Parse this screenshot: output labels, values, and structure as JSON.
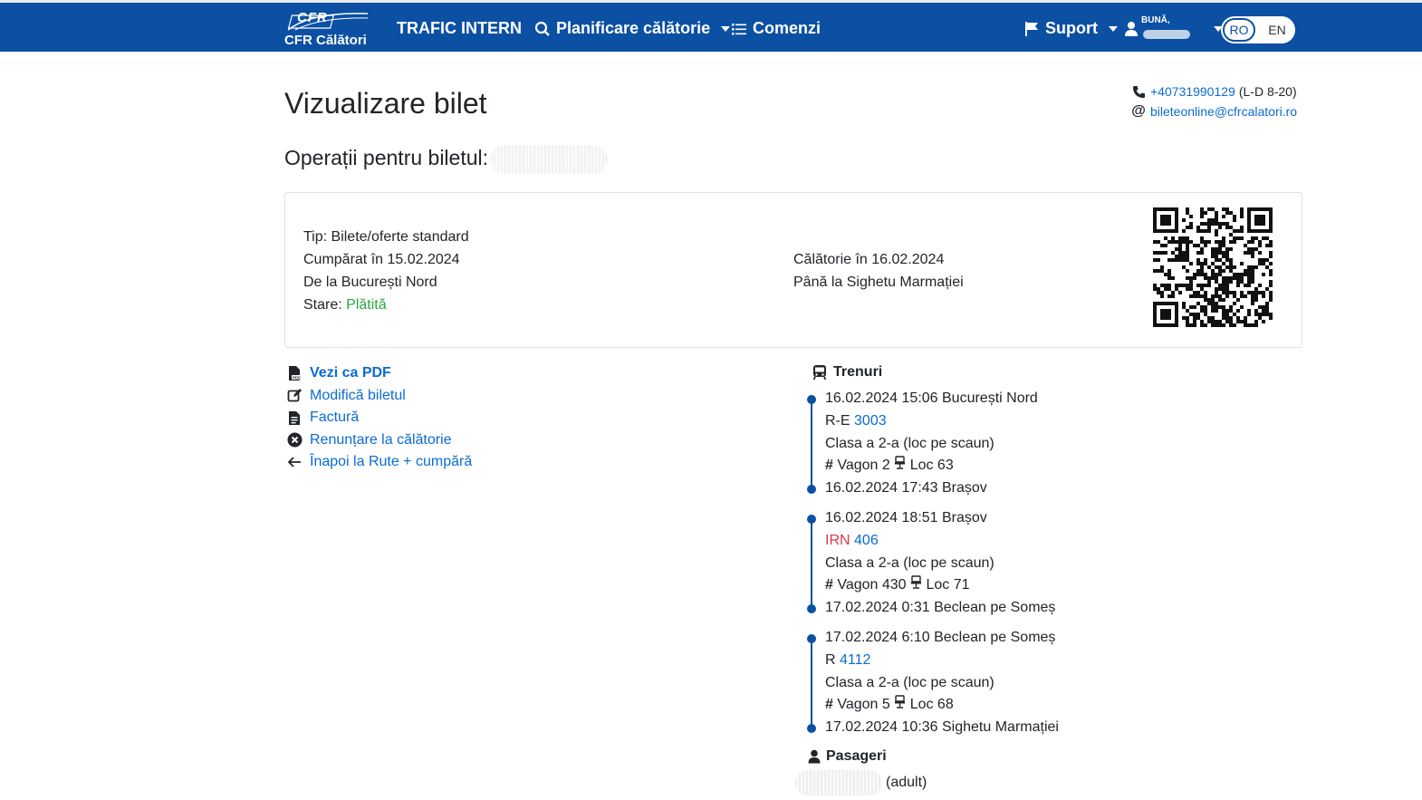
{
  "nav": {
    "logo_abbr": "CFR",
    "logo_name": "CFR Călători",
    "trafic": "TRAFIC INTERN",
    "planificare": "Planificare călătorie",
    "comenzi": "Comenzi",
    "suport": "Suport",
    "greeting": "BUNĂ,",
    "lang_ro": "RO",
    "lang_en": "EN"
  },
  "contact": {
    "phone": "+40731990129",
    "hours": "(L-D 8-20)",
    "email": "bileteonline@cfrcalatori.ro"
  },
  "page": {
    "title": "Vizualizare bilet",
    "subtitle": "Operații pentru biletul:"
  },
  "ticket": {
    "type": "Tip: Bilete/oferte standard",
    "purchased": "Cumpărat în 15.02.2024",
    "from": "De la București Nord",
    "status_label": "Stare: ",
    "status_value": "Plătită",
    "travel": "Călătorie în 16.02.2024",
    "to": "Până la Sighetu Marmației",
    "status_color": "#28a745"
  },
  "actions": [
    {
      "label": "Vezi ca PDF",
      "icon": "pdf-icon"
    },
    {
      "label": "Modifică biletul",
      "icon": "edit-icon"
    },
    {
      "label": "Factură",
      "icon": "invoice-icon"
    },
    {
      "label": "Renunțare la călătorie",
      "icon": "cancel-circle-icon"
    },
    {
      "label": "Înapoi la Rute + cumpără",
      "icon": "arrow-left-icon"
    }
  ],
  "trains": {
    "title": "Trenuri",
    "legs": [
      {
        "depart": "16.02.2024 15:06 București Nord",
        "category": "R-E",
        "number": "3003",
        "class": "Clasa a 2-a (loc pe scaun)",
        "wagon": "Vagon 2",
        "seat": "Loc 63",
        "arrive": "16.02.2024 17:43 Brașov"
      },
      {
        "depart": "16.02.2024 18:51 Brașov",
        "category": "IRN",
        "number": "406",
        "class": "Clasa a 2-a (loc pe scaun)",
        "wagon": "Vagon 430",
        "seat": "Loc 71",
        "arrive": "17.02.2024 0:31 Beclean pe Someș"
      },
      {
        "depart": "17.02.2024 6:10 Beclean pe Someș",
        "category": "R",
        "number": "4112",
        "class": "Clasa a 2-a (loc pe scaun)",
        "wagon": "Vagon 5",
        "seat": "Loc 68",
        "arrive": "17.02.2024 10:36 Sighetu Marmației"
      }
    ]
  },
  "passengers": {
    "title": "Pasageri",
    "type": "(adult)"
  },
  "colors": {
    "brand": "#0b50a3",
    "link": "#0b6bd3",
    "irn": "#dc3545"
  }
}
